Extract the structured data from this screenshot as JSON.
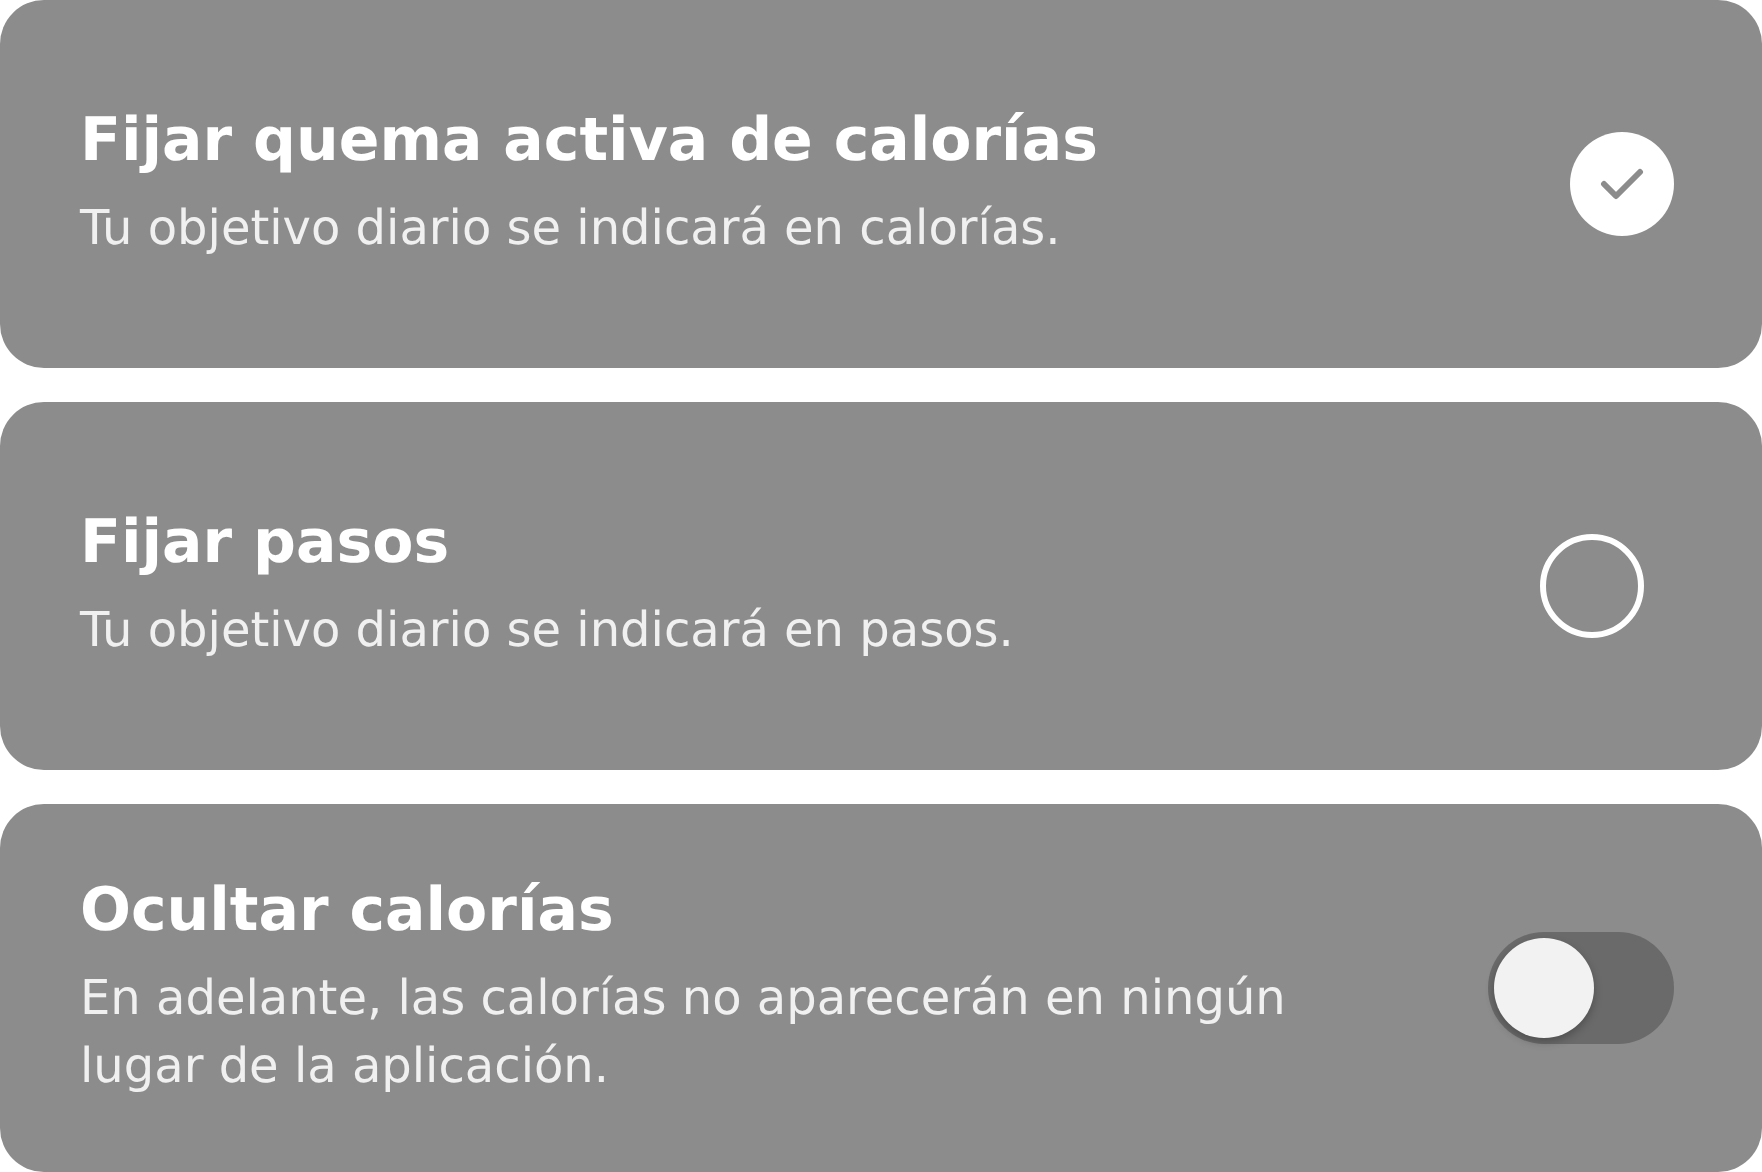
{
  "options": [
    {
      "kind": "radio",
      "title": "Fijar quema activa de calorías",
      "description": "Tu objetivo diario se indicará en calorías.",
      "selected": true
    },
    {
      "kind": "radio",
      "title": "Fijar pasos",
      "description": "Tu objetivo diario se indicará en pasos.",
      "selected": false
    },
    {
      "kind": "toggle",
      "title": "Ocultar calorías",
      "description": "En adelante, las calorías no aparecerán en ningún lugar de la aplicación.",
      "on": false
    }
  ]
}
